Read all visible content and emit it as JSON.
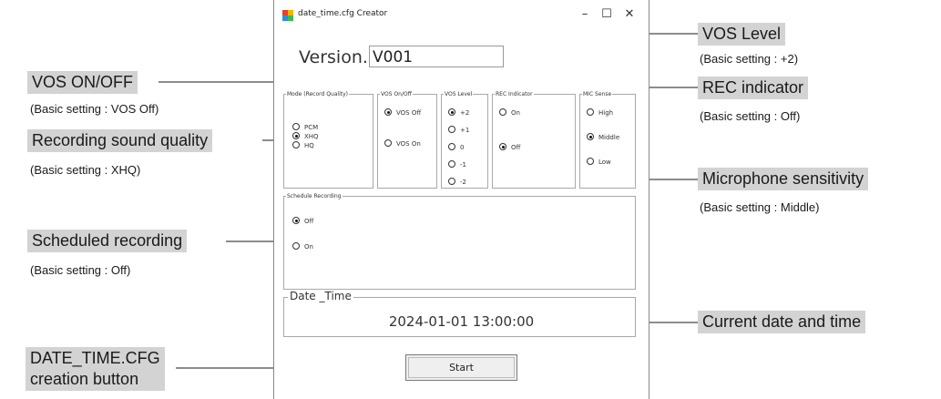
{
  "window": {
    "title": "date_time.cfg Creator",
    "minimize": "–",
    "maximize": "☐",
    "close": "✕"
  },
  "version": {
    "label": "Version.",
    "value": "V001"
  },
  "groups": {
    "mode": {
      "legend": "Mode (Record Quality)",
      "options": [
        {
          "label": "PCM",
          "selected": false
        },
        {
          "label": "XHQ",
          "selected": true
        },
        {
          "label": "HQ",
          "selected": false
        }
      ]
    },
    "vos_onoff": {
      "legend": "VOS On/Off",
      "options": [
        {
          "label": "VOS Off",
          "selected": true
        },
        {
          "label": "VOS On",
          "selected": false
        }
      ]
    },
    "vos_level": {
      "legend": "VOS Level",
      "options": [
        {
          "label": "+2",
          "selected": true
        },
        {
          "label": "+1",
          "selected": false
        },
        {
          "label": "0",
          "selected": false
        },
        {
          "label": "-1",
          "selected": false
        },
        {
          "label": "-2",
          "selected": false
        }
      ]
    },
    "rec_indicator": {
      "legend": "REC Indicator",
      "options": [
        {
          "label": "On",
          "selected": false
        },
        {
          "label": "Off",
          "selected": true
        }
      ]
    },
    "mic_sense": {
      "legend": "MIC Sense",
      "options": [
        {
          "label": "High",
          "selected": false
        },
        {
          "label": "Middle",
          "selected": true
        },
        {
          "label": "Low",
          "selected": false
        }
      ]
    },
    "schedule": {
      "legend": "Schedule Recording",
      "options": [
        {
          "label": "Off",
          "selected": true
        },
        {
          "label": "On",
          "selected": false
        }
      ]
    }
  },
  "date_time": {
    "legend": "Date _Time",
    "value": "2024-01-01 13:00:00"
  },
  "start_button": "Start",
  "annotations": {
    "vos_onoff": {
      "title": "VOS ON/OFF",
      "note": "(Basic setting : VOS Off)"
    },
    "record_quality": {
      "title": "Recording sound quality",
      "note": "(Basic setting : XHQ)"
    },
    "scheduled": {
      "title": "Scheduled recording",
      "note": "(Basic setting : Off)"
    },
    "create_button": {
      "title_line1": "DATE_TIME.CFG",
      "title_line2": "creation button"
    },
    "vos_level": {
      "title": "VOS Level",
      "note": "(Basic setting : +2)"
    },
    "rec_indicator": {
      "title": "REC indicator",
      "note": "(Basic setting : Off)"
    },
    "mic_sensitivity": {
      "title": "Microphone sensitivity",
      "note": "(Basic setting : Middle)"
    },
    "current_datetime": {
      "title": "Current date and time"
    }
  },
  "colors": {
    "callout_bg": "#d3d3d3",
    "window_border": "#8a8a8a",
    "icon_colors": [
      "#e8402a",
      "#f6b400",
      "#2f8de4",
      "#3cba54"
    ]
  },
  "icons": {
    "app": "windows-app-icon",
    "radio": "radio-button-icon"
  }
}
